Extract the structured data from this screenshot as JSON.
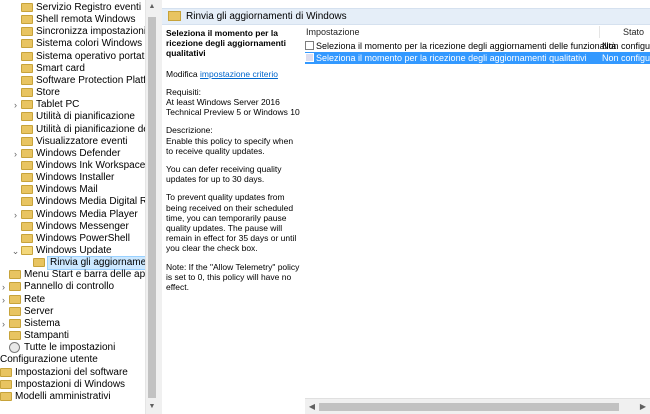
{
  "tree": {
    "items": [
      {
        "label": "Servizio Registro eventi",
        "expander": "",
        "indent": 2,
        "selected": false,
        "icon": "folder"
      },
      {
        "label": "Shell remota Windows",
        "expander": "",
        "indent": 2,
        "selected": false,
        "icon": "folder"
      },
      {
        "label": "Sincronizza impostazioni",
        "expander": "",
        "indent": 2,
        "selected": false,
        "icon": "folder"
      },
      {
        "label": "Sistema colori Windows",
        "expander": "",
        "indent": 2,
        "selected": false,
        "icon": "folder"
      },
      {
        "label": "Sistema operativo portatile",
        "expander": "",
        "indent": 2,
        "selected": false,
        "icon": "folder"
      },
      {
        "label": "Smart card",
        "expander": "",
        "indent": 2,
        "selected": false,
        "icon": "folder"
      },
      {
        "label": "Software Protection Platform",
        "expander": "",
        "indent": 2,
        "selected": false,
        "icon": "folder"
      },
      {
        "label": "Store",
        "expander": "",
        "indent": 2,
        "selected": false,
        "icon": "folder"
      },
      {
        "label": "Tablet PC",
        "expander": ">",
        "indent": 2,
        "selected": false,
        "icon": "folder"
      },
      {
        "label": "Utilità di pianificazione",
        "expander": "",
        "indent": 2,
        "selected": false,
        "icon": "folder"
      },
      {
        "label": "Utilità di pianificazione della m",
        "expander": "",
        "indent": 2,
        "selected": false,
        "icon": "folder"
      },
      {
        "label": "Visualizzatore eventi",
        "expander": "",
        "indent": 2,
        "selected": false,
        "icon": "folder"
      },
      {
        "label": "Windows Defender",
        "expander": ">",
        "indent": 2,
        "selected": false,
        "icon": "folder"
      },
      {
        "label": "Windows Ink Workspace",
        "expander": "",
        "indent": 2,
        "selected": false,
        "icon": "folder"
      },
      {
        "label": "Windows Installer",
        "expander": "",
        "indent": 2,
        "selected": false,
        "icon": "folder"
      },
      {
        "label": "Windows Mail",
        "expander": "",
        "indent": 2,
        "selected": false,
        "icon": "folder"
      },
      {
        "label": "Windows Media Digital Rights M",
        "expander": "",
        "indent": 2,
        "selected": false,
        "icon": "folder"
      },
      {
        "label": "Windows Media Player",
        "expander": ">",
        "indent": 2,
        "selected": false,
        "icon": "folder"
      },
      {
        "label": "Windows Messenger",
        "expander": "",
        "indent": 2,
        "selected": false,
        "icon": "folder"
      },
      {
        "label": "Windows PowerShell",
        "expander": "",
        "indent": 2,
        "selected": false,
        "icon": "folder"
      },
      {
        "label": "Windows Update",
        "expander": "v",
        "indent": 2,
        "selected": false,
        "icon": "folder-open"
      },
      {
        "label": "Rinvia gli aggiornamenti di",
        "expander": "",
        "indent": 3,
        "selected": true,
        "icon": "folder"
      },
      {
        "label": "Menu Start e barra delle applicazio",
        "expander": "",
        "indent": 1,
        "selected": false,
        "icon": "folder"
      },
      {
        "label": "Pannello di controllo",
        "expander": ">",
        "indent": 1,
        "selected": false,
        "icon": "folder"
      },
      {
        "label": "Rete",
        "expander": ">",
        "indent": 1,
        "selected": false,
        "icon": "folder"
      },
      {
        "label": "Server",
        "expander": "",
        "indent": 1,
        "selected": false,
        "icon": "folder"
      },
      {
        "label": "Sistema",
        "expander": ">",
        "indent": 1,
        "selected": false,
        "icon": "folder"
      },
      {
        "label": "Stampanti",
        "expander": "",
        "indent": 1,
        "selected": false,
        "icon": "folder"
      },
      {
        "label": "Tutte le impostazioni",
        "expander": "",
        "indent": 1,
        "selected": false,
        "icon": "settings"
      },
      {
        "label": "Configurazione utente",
        "expander": "",
        "indent": 0,
        "selected": false,
        "icon": "none"
      },
      {
        "label": "Impostazioni del software",
        "expander": "",
        "indent": 0,
        "selected": false,
        "icon": "folder"
      },
      {
        "label": "Impostazioni di Windows",
        "expander": "",
        "indent": 0,
        "selected": false,
        "icon": "folder"
      },
      {
        "label": "Modelli amministrativi",
        "expander": "",
        "indent": 0,
        "selected": false,
        "icon": "folder"
      }
    ]
  },
  "header": {
    "title": "Rinvia gli aggiornamenti di Windows"
  },
  "description": {
    "policy_title": "Seleziona il momento per la ricezione degli aggiornamenti qualitativi",
    "modify_prefix": "Modifica ",
    "modify_link": "impostazione criterio",
    "requirements_label": "Requisiti:",
    "requirements_text": "At least Windows Server 2016 Technical Preview 5 or Windows 10",
    "description_label": "Descrizione:",
    "para1": "Enable this policy to specify when to receive quality updates.",
    "para2": "You can defer receiving quality updates for up to 30 days.",
    "para3": "To prevent quality updates from being received on their scheduled time, you can temporarily pause quality updates. The pause will remain in effect for 35 days or until you clear the check box.",
    "para4": "Note: If the \"Allow Telemetry\" policy is set to 0, this policy will have no effect."
  },
  "list": {
    "columns": {
      "setting": "Impostazione",
      "state": "Stato"
    },
    "rows": [
      {
        "name": "Seleziona il momento per la ricezione degli aggiornamenti delle funzionalità",
        "state": "Non configur",
        "selected": false
      },
      {
        "name": "Seleziona il momento per la ricezione degli aggiornamenti qualitativi",
        "state": "Non configur",
        "selected": true
      }
    ]
  },
  "colors": {
    "selection": "#3399ff",
    "header_bg": "#e5eef8",
    "folder": "#e8c461",
    "link": "#0066cc"
  }
}
